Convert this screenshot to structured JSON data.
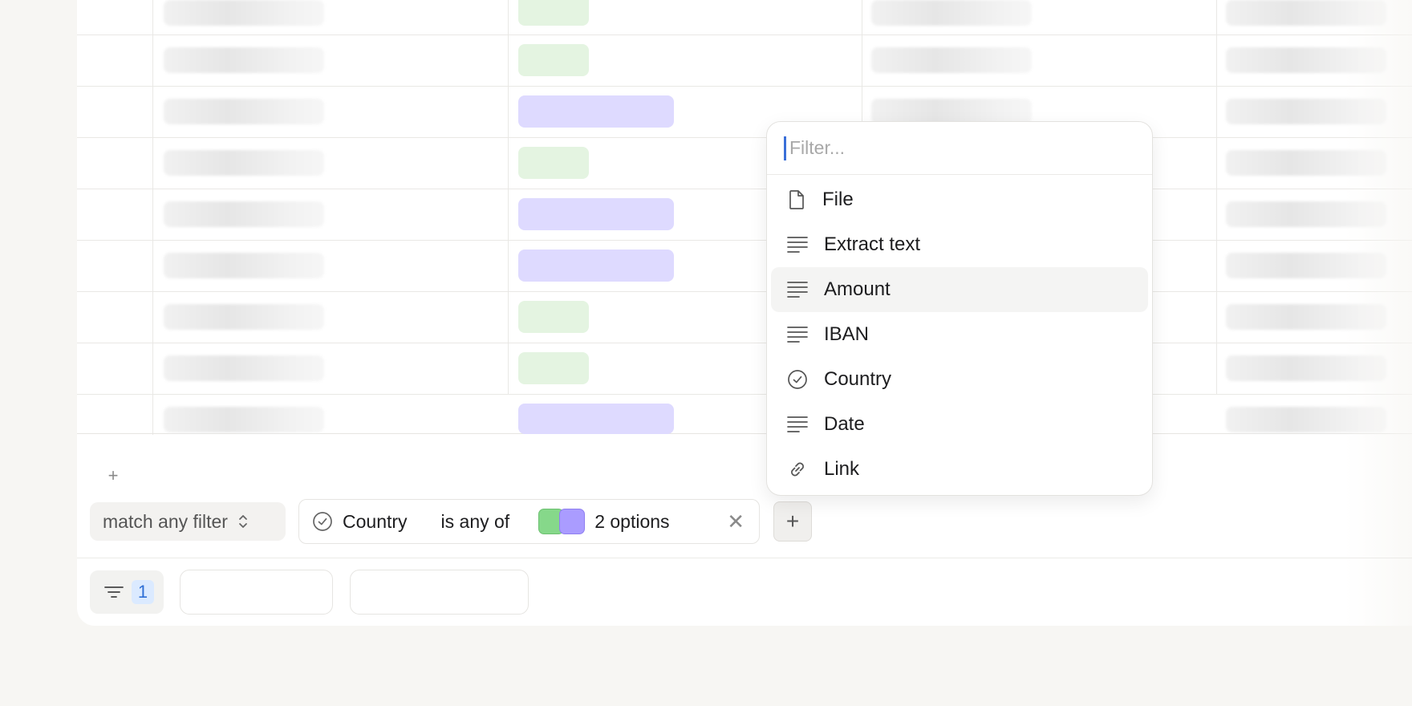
{
  "dropdown": {
    "filter_placeholder": "Filter...",
    "items": [
      {
        "label": "File",
        "icon": "file-icon"
      },
      {
        "label": "Extract text",
        "icon": "text-lines-icon"
      },
      {
        "label": "Amount",
        "icon": "text-lines-icon",
        "highlighted": true
      },
      {
        "label": "IBAN",
        "icon": "text-lines-icon"
      },
      {
        "label": "Country",
        "icon": "check-circle-icon"
      },
      {
        "label": "Date",
        "icon": "text-lines-icon"
      },
      {
        "label": "Link",
        "icon": "link-icon"
      }
    ]
  },
  "table": {
    "add_row_symbol": "+",
    "status_pill_colors": {
      "green": "#e4f4e1",
      "purple": "#dedaff"
    }
  },
  "filter_bar": {
    "match_label": "match any filter",
    "filter": {
      "field": "Country",
      "operator": "is any of",
      "value": "2 options",
      "option_colors": [
        "#86d88a",
        "#aa9cff"
      ]
    },
    "add_filter_symbol": "+"
  },
  "toolbar": {
    "filter_count": "1"
  }
}
